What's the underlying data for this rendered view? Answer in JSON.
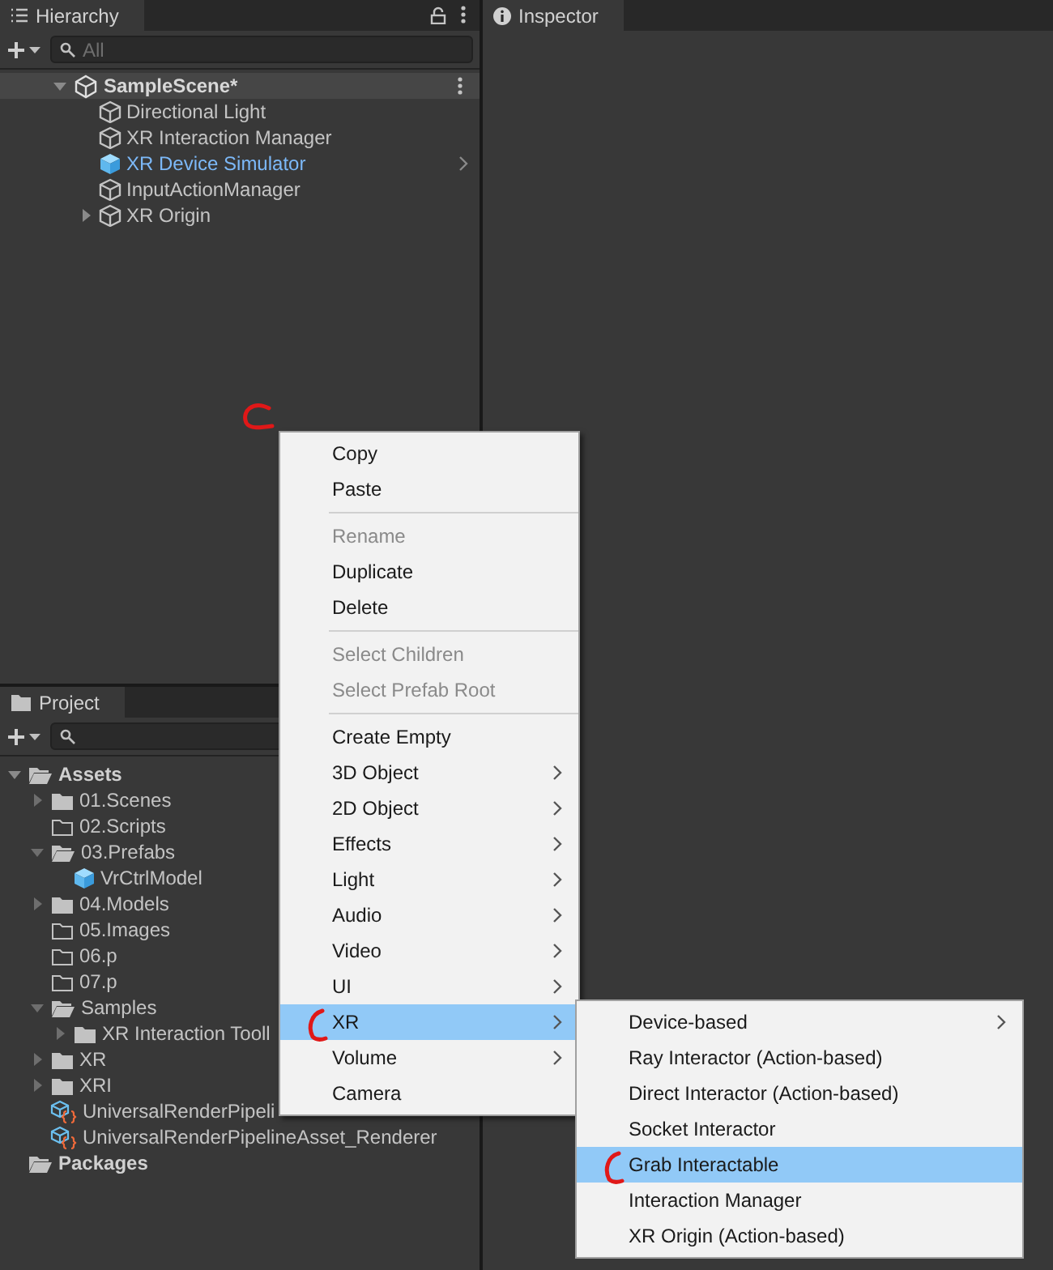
{
  "hierarchy": {
    "tab": "Hierarchy",
    "search": {
      "placeholder": "All"
    },
    "scene": {
      "name": "SampleScene*",
      "expanded": true,
      "children": [
        {
          "name": "Directional Light",
          "kind": "object"
        },
        {
          "name": "XR Interaction Manager",
          "kind": "object"
        },
        {
          "name": "XR Device Simulator",
          "kind": "prefab",
          "has_arrow": true
        },
        {
          "name": "InputActionManager",
          "kind": "object"
        },
        {
          "name": "XR Origin",
          "kind": "object",
          "expanded": false
        }
      ]
    },
    "click_mark": true
  },
  "inspector": {
    "tab": "Inspector"
  },
  "project": {
    "tab": "Project",
    "tree": [
      {
        "name": "Assets",
        "kind": "root",
        "expanded": true,
        "children": [
          {
            "name": "01.Scenes",
            "kind": "folder",
            "expanded": false
          },
          {
            "name": "02.Scripts",
            "kind": "empty-folder"
          },
          {
            "name": "03.Prefabs",
            "kind": "open-folder",
            "expanded": true,
            "children": [
              {
                "name": "VrCtrlModel",
                "kind": "prefab"
              }
            ]
          },
          {
            "name": "04.Models",
            "kind": "folder",
            "expanded": false
          },
          {
            "name": "05.Images",
            "kind": "empty-folder"
          },
          {
            "name": "06.p",
            "kind": "empty-folder"
          },
          {
            "name": "07.p",
            "kind": "empty-folder"
          },
          {
            "name": "Samples",
            "kind": "open-folder",
            "expanded": true,
            "children": [
              {
                "name": "XR Interaction Tooll",
                "kind": "folder",
                "expanded": false
              }
            ]
          },
          {
            "name": "XR",
            "kind": "folder",
            "expanded": false
          },
          {
            "name": "XRI",
            "kind": "folder",
            "expanded": false
          },
          {
            "name": "UniversalRenderPipeli",
            "kind": "asset"
          },
          {
            "name": "UniversalRenderPipelineAsset_Renderer",
            "kind": "asset"
          }
        ]
      },
      {
        "name": "Packages",
        "kind": "root"
      }
    ]
  },
  "context_menu": [
    {
      "kind": "item",
      "label": "Copy",
      "disabled": false,
      "submenu": false,
      "selected": false,
      "marked": false
    },
    {
      "kind": "item",
      "label": "Paste",
      "disabled": false,
      "submenu": false,
      "selected": false,
      "marked": false
    },
    {
      "kind": "separator"
    },
    {
      "kind": "item",
      "label": "Rename",
      "disabled": true,
      "submenu": false,
      "selected": false,
      "marked": false
    },
    {
      "kind": "item",
      "label": "Duplicate",
      "disabled": false,
      "submenu": false,
      "selected": false,
      "marked": false
    },
    {
      "kind": "item",
      "label": "Delete",
      "disabled": false,
      "submenu": false,
      "selected": false,
      "marked": false
    },
    {
      "kind": "separator"
    },
    {
      "kind": "item",
      "label": "Select Children",
      "disabled": true,
      "submenu": false,
      "selected": false,
      "marked": false
    },
    {
      "kind": "item",
      "label": "Select Prefab Root",
      "disabled": true,
      "submenu": false,
      "selected": false,
      "marked": false
    },
    {
      "kind": "separator"
    },
    {
      "kind": "item",
      "label": "Create Empty",
      "disabled": false,
      "submenu": false,
      "selected": false,
      "marked": false
    },
    {
      "kind": "item",
      "label": "3D Object",
      "disabled": false,
      "submenu": true,
      "selected": false,
      "marked": false
    },
    {
      "kind": "item",
      "label": "2D Object",
      "disabled": false,
      "submenu": true,
      "selected": false,
      "marked": false
    },
    {
      "kind": "item",
      "label": "Effects",
      "disabled": false,
      "submenu": true,
      "selected": false,
      "marked": false
    },
    {
      "kind": "item",
      "label": "Light",
      "disabled": false,
      "submenu": true,
      "selected": false,
      "marked": false
    },
    {
      "kind": "item",
      "label": "Audio",
      "disabled": false,
      "submenu": true,
      "selected": false,
      "marked": false
    },
    {
      "kind": "item",
      "label": "Video",
      "disabled": false,
      "submenu": true,
      "selected": false,
      "marked": false
    },
    {
      "kind": "item",
      "label": "UI",
      "disabled": false,
      "submenu": true,
      "selected": false,
      "marked": false
    },
    {
      "kind": "item",
      "label": "XR",
      "disabled": false,
      "submenu": true,
      "selected": true,
      "marked": true
    },
    {
      "kind": "item",
      "label": "Volume",
      "disabled": false,
      "submenu": true,
      "selected": false,
      "marked": false
    },
    {
      "kind": "item",
      "label": "Camera",
      "disabled": false,
      "submenu": false,
      "selected": false,
      "marked": false
    }
  ],
  "submenu": [
    {
      "kind": "item",
      "label": "Device-based",
      "disabled": false,
      "submenu": true,
      "selected": false,
      "marked": false
    },
    {
      "kind": "item",
      "label": "Ray Interactor (Action-based)",
      "disabled": false,
      "submenu": false,
      "selected": false,
      "marked": false
    },
    {
      "kind": "item",
      "label": "Direct Interactor (Action-based)",
      "disabled": false,
      "submenu": false,
      "selected": false,
      "marked": false
    },
    {
      "kind": "item",
      "label": "Socket Interactor",
      "disabled": false,
      "submenu": false,
      "selected": false,
      "marked": false
    },
    {
      "kind": "item",
      "label": "Grab Interactable",
      "disabled": false,
      "submenu": false,
      "selected": true,
      "marked": true
    },
    {
      "kind": "item",
      "label": "Interaction Manager",
      "disabled": false,
      "submenu": false,
      "selected": false,
      "marked": false
    },
    {
      "kind": "item",
      "label": "XR Origin (Action-based)",
      "disabled": false,
      "submenu": false,
      "selected": false,
      "marked": false
    }
  ]
}
